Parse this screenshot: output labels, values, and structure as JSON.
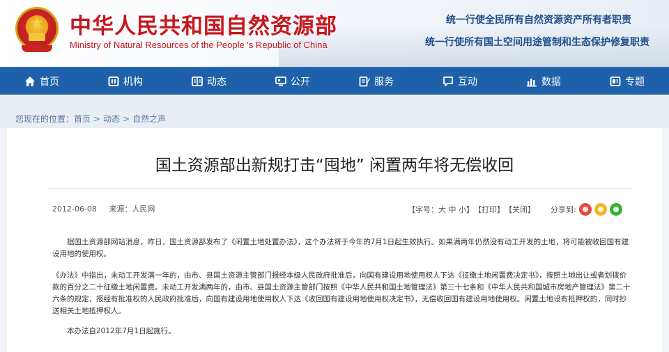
{
  "header": {
    "title_cn": "中华人民共和国自然资源部",
    "title_en": "Ministry of Natural Resources of the People 's Republic of China",
    "slogan_1": "统一行使全民所有自然资源资产所有者职责",
    "slogan_2": "统一行使所有国土空间用途管制和生态保护修复职责"
  },
  "nav": {
    "items": [
      {
        "label": "首页",
        "icon": "home-icon"
      },
      {
        "label": "机构",
        "icon": "institution-icon"
      },
      {
        "label": "动态",
        "icon": "news-icon"
      },
      {
        "label": "公开",
        "icon": "monitor-icon"
      },
      {
        "label": "服务",
        "icon": "edit-icon"
      },
      {
        "label": "互动",
        "icon": "chat-icon"
      },
      {
        "label": "数据",
        "icon": "bar-chart-icon"
      },
      {
        "label": "专题",
        "icon": "topic-icon"
      }
    ]
  },
  "breadcrumb": {
    "prefix": "您现在的位置：",
    "items": [
      "首页",
      "动态",
      "自然之声"
    ],
    "separator": ">"
  },
  "article": {
    "title": "国土资源部出新规打击“囤地” 闲置两年将无偿收回",
    "date": "2012-06-08",
    "source": "来源：人民网",
    "font_size_label": "【字号：",
    "font_large": "大",
    "font_medium": "中",
    "font_small": "小",
    "font_size_close": "】",
    "print": "【打印】",
    "close": "【关闭】",
    "share_label": "分享到:",
    "paragraphs": [
      "据国土资源部网站消息，昨日，国土资源部发布了《闲置土地处置办法》，这个办法将于今年的7月1日起生效执行。如果满两年仍然没有动工开发的土地，将可能被收回国有建设用地的使用权。",
      "《办法》中指出，未动工开发满一年的，由市、县国土资源主管部门报经本级人民政府批准后，向国有建设用地使用权人下达《征缴土地闲置费决定书》，按照土地出让或者划拨价款的百分之二十征缴土地闲置费。未动工开发满两年的，由市、县国土资源主管部门按照《中华人民共和国土地管理法》第三十七条和《中华人民共和国城市房地产管理法》第二十六条的规定，报经有批准权的人民政府批准后，向国有建设用地使用权人下达《收回国有建设用地使用权决定书》，无偿收回国有建设用地使用权。闲置土地设有抵押权的，同时抄送相关土地抵押权人。",
      "本办法自2012年7月1日起施行。"
    ]
  },
  "colors": {
    "brand_red": "#c8161d",
    "nav_blue": "#1e61aa",
    "slogan_blue": "#1f4e8c"
  }
}
